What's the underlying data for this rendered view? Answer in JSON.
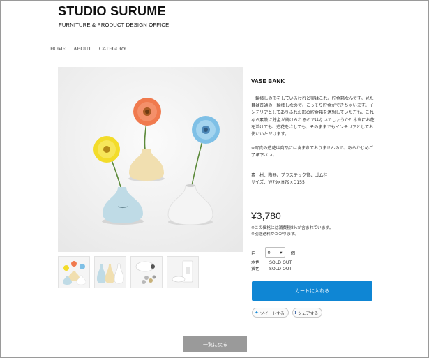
{
  "site": {
    "title": "STUDIO SURUME",
    "subtitle": "FURNITURE & PRODUCT DESIGN OFFICE"
  },
  "nav": {
    "items": [
      "HOME",
      "ABOUT",
      "CATEGORY"
    ]
  },
  "product": {
    "name": "VASE BANK",
    "description": [
      "一輪挿しの形をしているけれど実はこれ、貯金箱なんです。見た目は普通の一輪挿しなので、こっそり貯金ができちゃいます。インテリアとしてありふれた形の貯金箱を連想していた方も、これなら素敵に貯金が続けられるのではないでしょうか？本当にお花を活けても、造花をさしても、そのままでもインテリアとしてお使いいただけます。",
      "※写真の造花は商品には含まれておりませんので、あらかじめご了承下さい。"
    ],
    "material": "素　材：陶器、プラスチック管、ゴム栓",
    "size": "サイズ：W79×H79×D155",
    "price": "¥3,780",
    "tax_note": "※この価格には消費税8%が含まれています。",
    "shipping_note": "※別途送料がかかります。",
    "quantity": {
      "label": "白",
      "value": "0",
      "unit": "個"
    },
    "stock": [
      {
        "color": "水色",
        "status": "SOLD OUT"
      },
      {
        "color": "黄色",
        "status": "SOLD OUT"
      }
    ],
    "cart_label": "カートに入れる"
  },
  "social": {
    "tweet_label": "ツイートする",
    "share_label": "シェアする"
  },
  "back_label": "一覧に戻る",
  "colors": {
    "accent": "#0f86d4",
    "back_button": "#9a9a9a"
  },
  "icons": {
    "tweet": "twitter-bird-icon",
    "share": "facebook-f-icon",
    "dropdown": "chevron-down-icon"
  }
}
